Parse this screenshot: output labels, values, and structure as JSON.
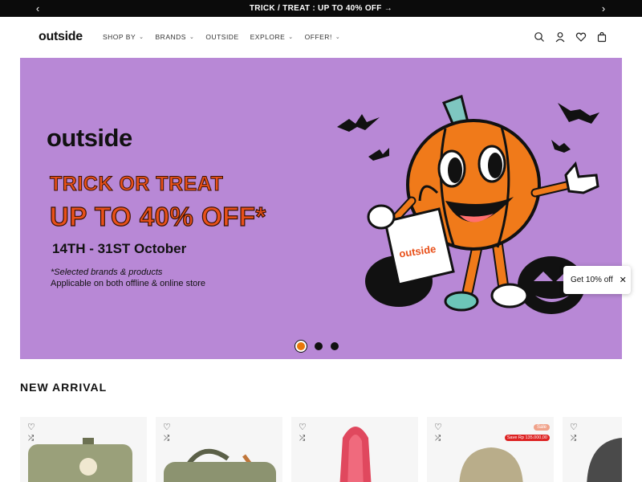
{
  "announcement": {
    "prev": "‹",
    "text": "TRICK / TREAT : UP TO 40% OFF →",
    "next": "›"
  },
  "header": {
    "logo": "outside",
    "nav": [
      {
        "label": "SHOP BY",
        "chevron": "⌄"
      },
      {
        "label": "BRANDS",
        "chevron": "⌄"
      },
      {
        "label": "OUTSIDE",
        "chevron": ""
      },
      {
        "label": "EXPLORE",
        "chevron": "⌄"
      },
      {
        "label": "OFFER!",
        "chevron": "⌄"
      }
    ],
    "icons": [
      "search-icon",
      "account-icon",
      "wishlist-icon",
      "cart-icon"
    ]
  },
  "hero": {
    "brand": "outside",
    "headline_1": "TRICK OR TREAT",
    "headline_2": "UP TO 40% OFF*",
    "dates": "14TH - 31ST October",
    "note_1": "*Selected brands & products",
    "note_2": "Applicable on both offline & online store",
    "bag_label": "outside",
    "background_color": "#b888d6",
    "accent_color": "#e8501a",
    "slides": 3,
    "active_slide": 1
  },
  "discount_popup": {
    "label": "Get 10% off",
    "close": "✕"
  },
  "new_arrival": {
    "title": "NEW ARRIVAL",
    "products": [
      {
        "wish": "♡",
        "compare": "⤮",
        "sale": "",
        "save": ""
      },
      {
        "wish": "♡",
        "compare": "⤮",
        "sale": "",
        "save": ""
      },
      {
        "wish": "♡",
        "compare": "⤮",
        "sale": "",
        "save": ""
      },
      {
        "wish": "♡",
        "compare": "⤮",
        "sale": "Sale",
        "save": "Save Rp 135.000,00"
      },
      {
        "wish": "♡",
        "compare": "⤮",
        "sale": "",
        "save": ""
      }
    ]
  }
}
